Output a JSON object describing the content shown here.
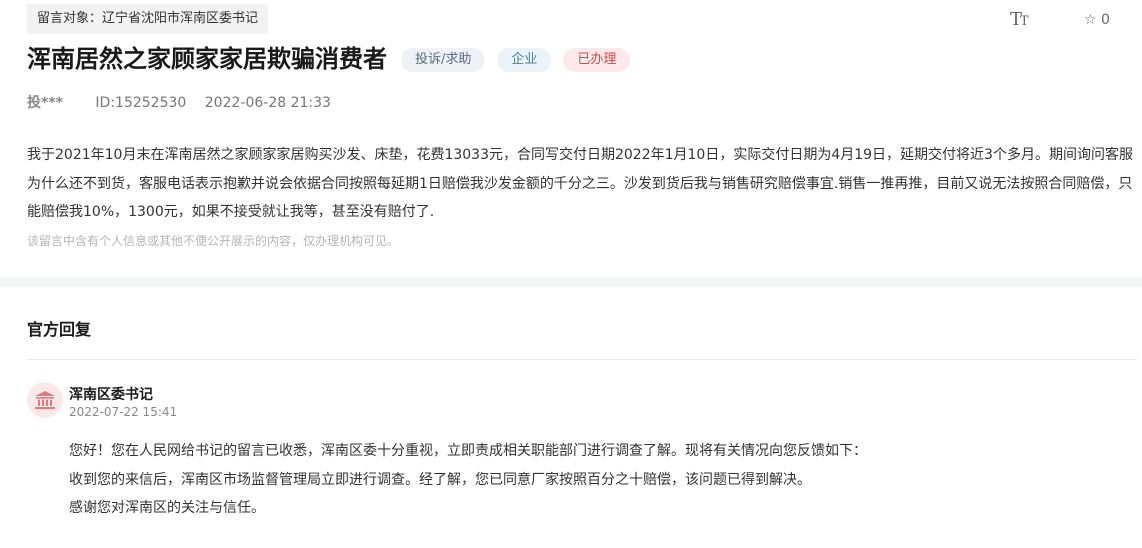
{
  "message": {
    "target_label": "留言对象：辽宁省沈阳市浑南区委书记",
    "font_tool_big": "T",
    "font_tool_small": "T",
    "favorite_count": "0",
    "title": "浑南居然之家顾家家居欺骗消费者",
    "badges": {
      "type": "投诉/求助",
      "org": "企业",
      "status": "已办理"
    },
    "author": "投***",
    "id": "ID:15252530",
    "date": "2022-06-28 21:33",
    "content": "我于2021年10月末在浑南居然之家顾家家居购买沙发、床垫，花费13033元，合同写交付日期2022年1月10日，实际交付日期为4月19日，延期交付将近3个多月。期间询问客服为什么还不到货，客服电话表示抱歉并说会依据合同按照每延期1日赔偿我沙发金额的千分之三。沙发到货后我与销售研究赔偿事宜.销售一推再推，目前又说无法按照合同赔偿，只能赔偿我10%，1300元，如果不接受就让我等，甚至没有赔付了.",
    "privacy_note": "该留言中含有个人信息或其他不便公开展示的内容，仅办理机构可见。"
  },
  "reply": {
    "heading": "官方回复",
    "org_name": "浑南区委书记",
    "time": "2022-07-22 15:41",
    "paragraphs": [
      "您好！您在人民网给书记的留言已收悉，浑南区委十分重视，立即责成相关职能部门进行调查了解。现将有关情况向您反馈如下：",
      "收到您的来信后，浑南区市场监督管理局立即进行调查。经了解，您已同意厂家按照百分之十赔偿，该问题已得到解决。",
      "感谢您对浑南区的关注与信任。"
    ]
  },
  "colors": {
    "status_red": "#d94545",
    "avatar_icon": "#e27a7a"
  }
}
